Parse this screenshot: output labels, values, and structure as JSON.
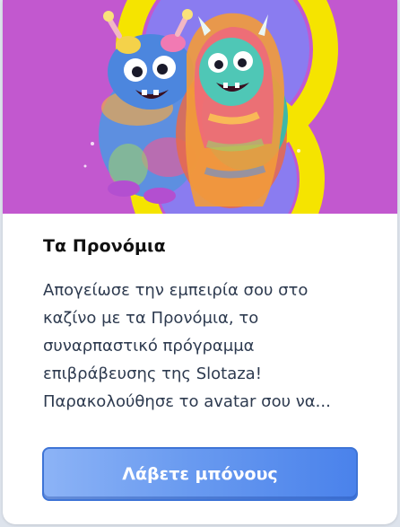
{
  "card": {
    "title": "Τα Προνόμια",
    "description_lines": [
      "Απογείωσε την εμπειρία σου στο",
      "καζίνο με τα Προνόμια, το",
      "συναρπαστικό πρόγραμμα",
      "επιβράβευσης της Slotaza!",
      "Παρακολούθησε το avatar σου να..."
    ],
    "button_label": "Λάβετε μπόνους",
    "image_alt_icon": "monsters-illustration"
  },
  "colors": {
    "hero_background": "#c258cf",
    "hero_ring": "#f5e400",
    "hero_inner": "#8a7cf0",
    "button_start": "#8cb3f6",
    "button_end": "#4a82eb",
    "button_border": "#3e74d6"
  }
}
